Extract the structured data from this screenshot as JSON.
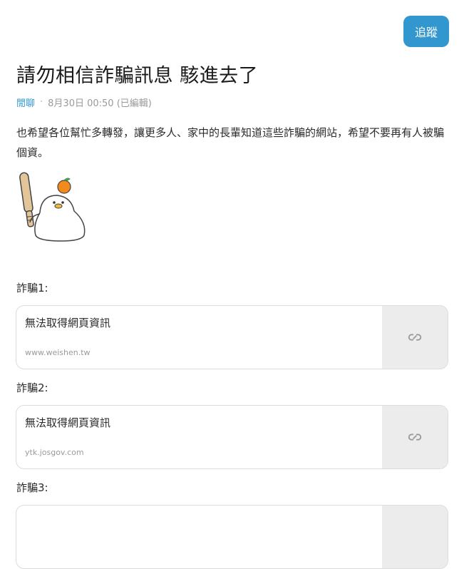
{
  "header": {
    "follow_label": "追蹤"
  },
  "post": {
    "title": "請勿相信詐騙訊息 駭進去了",
    "forum": "閒聊",
    "separator": "·",
    "timestamp": "8月30日 00:50 (已編輯)",
    "body": "也希望各位幫忙多轉發，讓更多人、家中的長輩知道這些詐騙的網站，希望不要再有人被騙個資。"
  },
  "links": [
    {
      "label": "詐騙1:",
      "title": "無法取得網頁資訊",
      "url": "www.weishen.tw"
    },
    {
      "label": "詐騙2:",
      "title": "無法取得網頁資訊",
      "url": "ytk.josgov.com"
    },
    {
      "label": "詐騙3:",
      "title": "",
      "url": ""
    }
  ],
  "colors": {
    "accent": "#3397cf",
    "thumb_bg": "#ececec"
  }
}
